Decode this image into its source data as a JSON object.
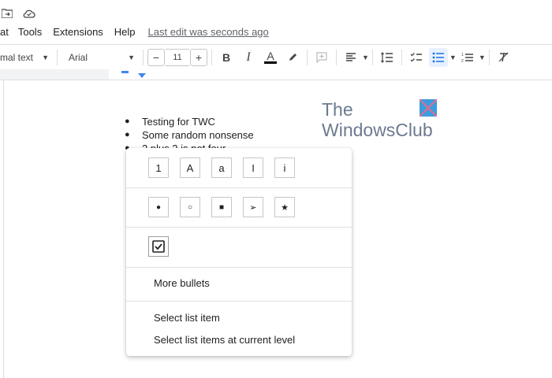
{
  "menubar": {
    "items": [
      "at",
      "Tools",
      "Extensions",
      "Help"
    ],
    "last_edit": "Last edit was seconds ago"
  },
  "toolbar": {
    "style_value": "mal text",
    "font_value": "Arial",
    "font_size": "11",
    "decrease": "−",
    "increase": "+",
    "bold": "B",
    "italic": "I",
    "text_color_letter": "A",
    "text_color": "#000000",
    "accent": "#1a73e8"
  },
  "document": {
    "list": [
      "Testing for TWC",
      "Some random nonsense",
      "2 plus 2 is not four"
    ]
  },
  "logo": {
    "line1": "The",
    "line2": "WindowsClub"
  },
  "popup": {
    "numbered_presets": [
      "1",
      "A",
      "a",
      "I",
      "i"
    ],
    "bullet_presets": [
      "●",
      "○",
      "■",
      "➢",
      "★"
    ],
    "checklist_preset_icon": "checkbox-icon",
    "more_bullets": "More bullets",
    "select_list_item": "Select list item",
    "select_current_level": "Select list items at current level"
  }
}
